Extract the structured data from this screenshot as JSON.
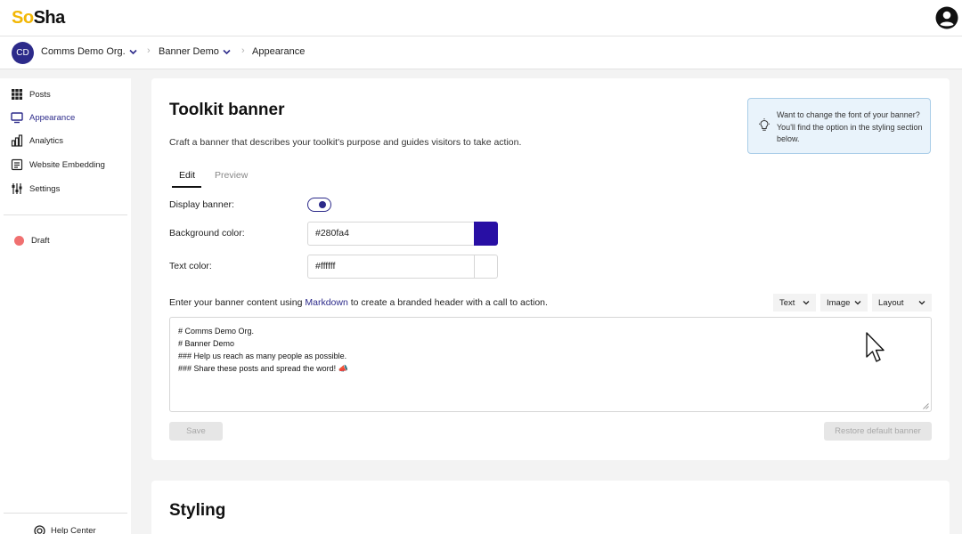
{
  "app": {
    "logo_part1": "S",
    "logo_part2": "o",
    "logo_part3": "Sha",
    "account_icon": "account-circle-icon"
  },
  "breadcrumb": {
    "avatar_initials": "CD",
    "org": "Comms Demo Org.",
    "project": "Banner Demo",
    "page": "Appearance"
  },
  "sidebar": {
    "items": [
      {
        "label": "Posts",
        "icon": "grid-icon"
      },
      {
        "label": "Appearance",
        "icon": "monitor-icon"
      },
      {
        "label": "Analytics",
        "icon": "bar-chart-icon"
      },
      {
        "label": "Website Embedding",
        "icon": "embed-icon"
      },
      {
        "label": "Settings",
        "icon": "sliders-icon"
      }
    ],
    "status_label": "Draft",
    "help_label": "Help Center"
  },
  "banner_card": {
    "title": "Toolkit banner",
    "subtitle": "Craft a banner that describes your toolkit's purpose and guides visitors to take action.",
    "tip": "Want to change the font of your banner? You'll find the option in the styling section below.",
    "tabs": {
      "edit": "Edit",
      "preview": "Preview"
    },
    "display_banner_label": "Display banner:",
    "display_banner_on": true,
    "background_color_label": "Background color:",
    "background_color_value": "#280fa4",
    "text_color_label": "Text color:",
    "text_color_value": "#ffffff",
    "markdown_hint_before": "Enter your banner content using ",
    "markdown_link": "Markdown",
    "markdown_hint_after": " to create a branded header with a call to action.",
    "menus": {
      "text": "Text",
      "image": "Image",
      "layout": "Layout"
    },
    "content_lines": [
      "# Comms Demo Org.",
      "# Banner Demo",
      "### Help us reach as many people as possible.",
      "### Share these posts and spread the word! 📣"
    ],
    "save_label": "Save",
    "restore_label": "Restore default banner"
  },
  "styling_card": {
    "title": "Styling"
  },
  "colors": {
    "accent": "#2c2a8a",
    "background_swatch": "#280fa4",
    "text_swatch": "#ffffff",
    "tip_bg": "#e9f3fb",
    "draft": "#f07070"
  }
}
